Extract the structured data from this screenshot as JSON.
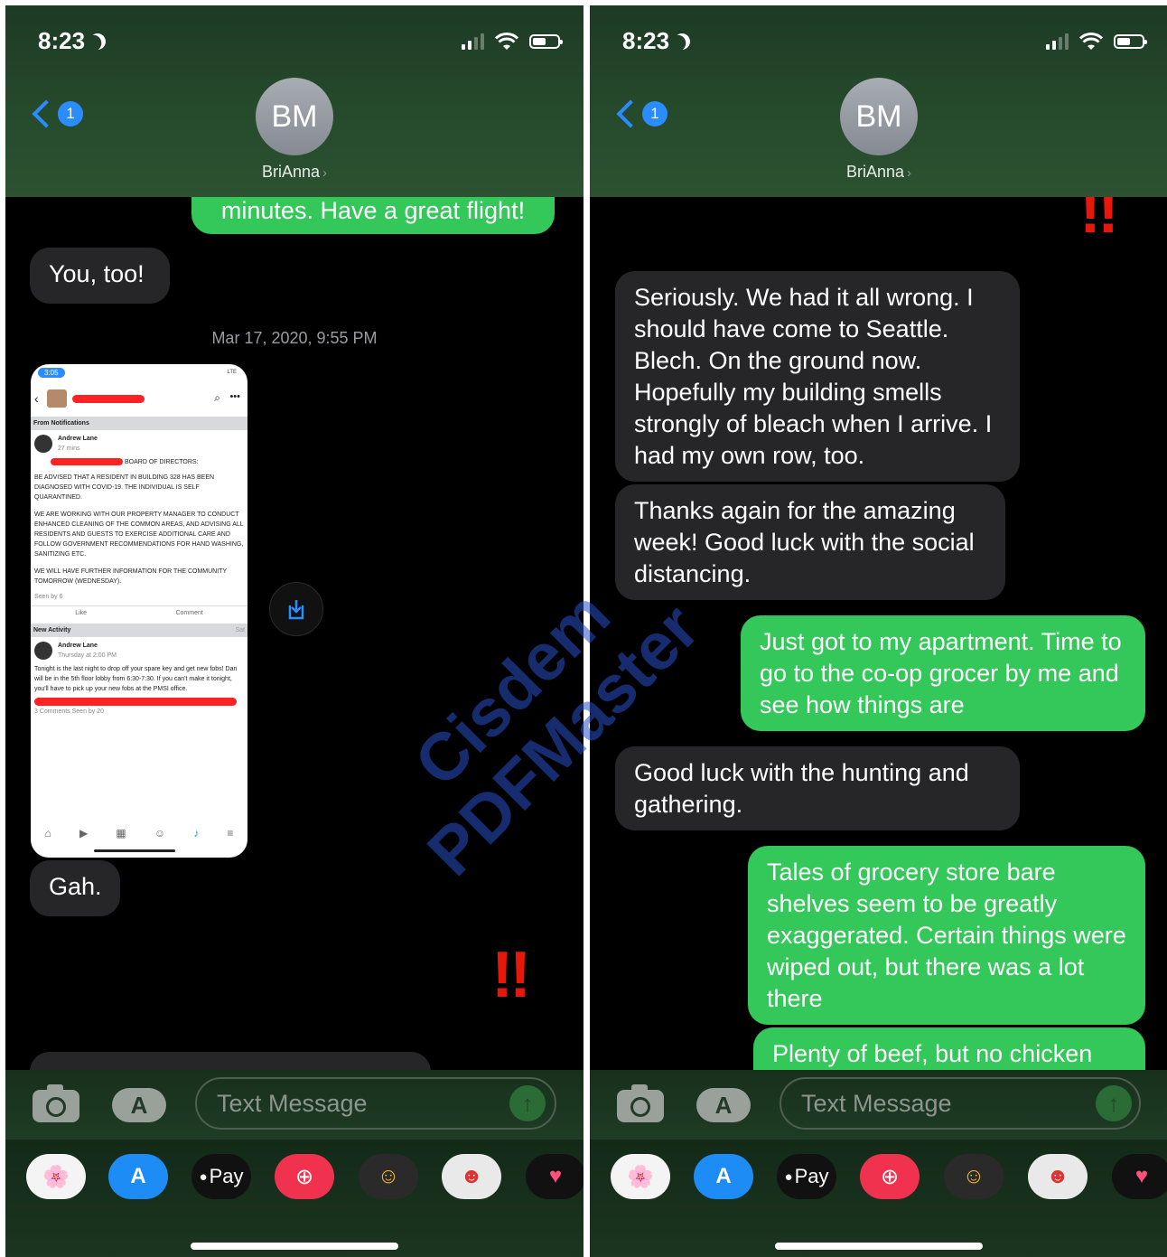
{
  "status_bar": {
    "time": "8:23"
  },
  "contact": {
    "initials": "BM",
    "name": "BriAnna",
    "back_badge": "1"
  },
  "composer": {
    "placeholder": "Text Message",
    "send_icon": "up-arrow-icon"
  },
  "app_drawer": [
    "photos-app",
    "app-store",
    "apple-pay",
    "web-search",
    "memoji-stickers",
    "animoji",
    "digital-touch"
  ],
  "app_drawer_labels": {
    "pay": "Pay"
  },
  "left_screen": {
    "partial_top": "minutes. Have a great flight!",
    "msg_you_too": "You, too!",
    "timestamp": "Mar 17, 2020, 9:55 PM",
    "msg_gah": "Gah.",
    "emphasis": "!!",
    "screenshot": {
      "time": "3:05",
      "network": "LTE",
      "section_notifications": "From Notifications",
      "author": "Andrew Lane",
      "post_time_1": "27 mins",
      "board_line": "BOARD OF DIRECTORS:",
      "post_p1": "BE ADVISED THAT A RESIDENT IN BUILDING 328 HAS BEEN DIAGNOSED WITH COVID-19. THE INDIVIDUAL IS SELF QUARANTINED.",
      "post_p2": "WE ARE WORKING WITH OUR PROPERTY MANAGER TO CONDUCT ENHANCED CLEANING OF THE COMMON AREAS, AND ADVISING ALL RESIDENTS AND GUESTS TO EXERCISE ADDITIONAL CARE AND FOLLOW GOVERNMENT RECOMMENDATIONS FOR HAND WASHING, SANITIZING ETC.",
      "post_p3": "WE WILL HAVE FURTHER INFORMATION FOR THE COMMUNITY TOMORROW (WEDNESDAY).",
      "seen_1": "Seen by 6",
      "like": "Like",
      "comment": "Comment",
      "section_activity": "New Activity",
      "activity_tag": "Sat",
      "post_time_2": "Thursday at 2:00 PM",
      "post2": "Tonight is the last night to drop off your spare key and get new fobs! Dan will be in the 5th floor lobby from 6:30-7:30. If you can't make it tonight, you'll have to pick up your new fobs at the PMSI office.",
      "footer": "3 Comments  Seen by 20"
    }
  },
  "right_screen": {
    "emphasis": "!!",
    "msg1": "Seriously. We had it all wrong. I should have come to Seattle. Blech. On the ground now. Hopefully my building smells strongly of bleach when I arrive. I had my own row, too.",
    "msg2": "Thanks again for the amazing week! Good luck with the social distancing.",
    "msg3": "Just got to my apartment. Time to go to the co-op grocer by me and see how things are",
    "msg4": "Good luck with the hunting and gathering.",
    "msg5": "Tales of grocery store bare shelves seem to be greatly exaggerated. Certain things were wiped out, but there was a lot there",
    "msg6": "Plenty of beef, but no chicken"
  },
  "watermark": {
    "line1": "Cisdem",
    "line2": "PDFMaster"
  },
  "colors": {
    "incoming": "#262628",
    "outgoing": "#34c759",
    "accent": "#2a8cff",
    "emphasis": "#e8170a"
  }
}
